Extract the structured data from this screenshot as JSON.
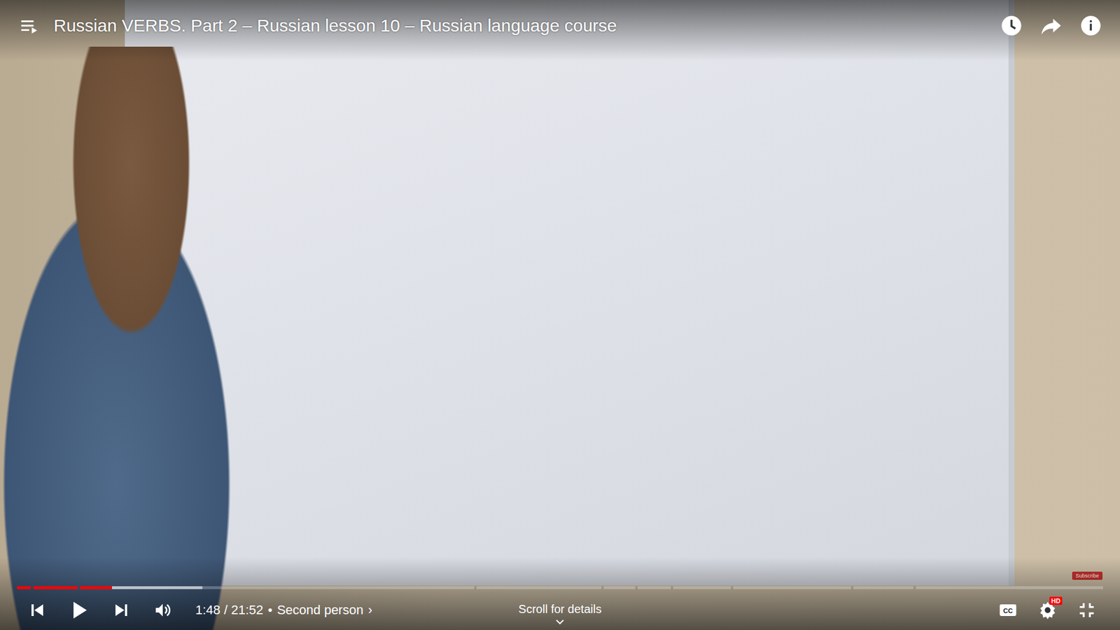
{
  "video": {
    "title": "Russian VERBS. Part 2 – Russian lesson 10 – Russian language course",
    "playing": false,
    "time_display": "1:48 / 21:52",
    "chapter_separator": "•",
    "chapter": "Second person",
    "chapter_arrow": "›"
  },
  "progress": {
    "level": 0.085,
    "buffered": 0.17,
    "chapter_ends": [
      0.013,
      0.055,
      0.425,
      0.542,
      0.572,
      0.603,
      0.657,
      0.768,
      0.824,
      1.0
    ]
  },
  "scroll_hint": "Scroll for details",
  "settings_badge": "HD",
  "watermark": "Subscribe",
  "captions": {
    "on": false
  }
}
